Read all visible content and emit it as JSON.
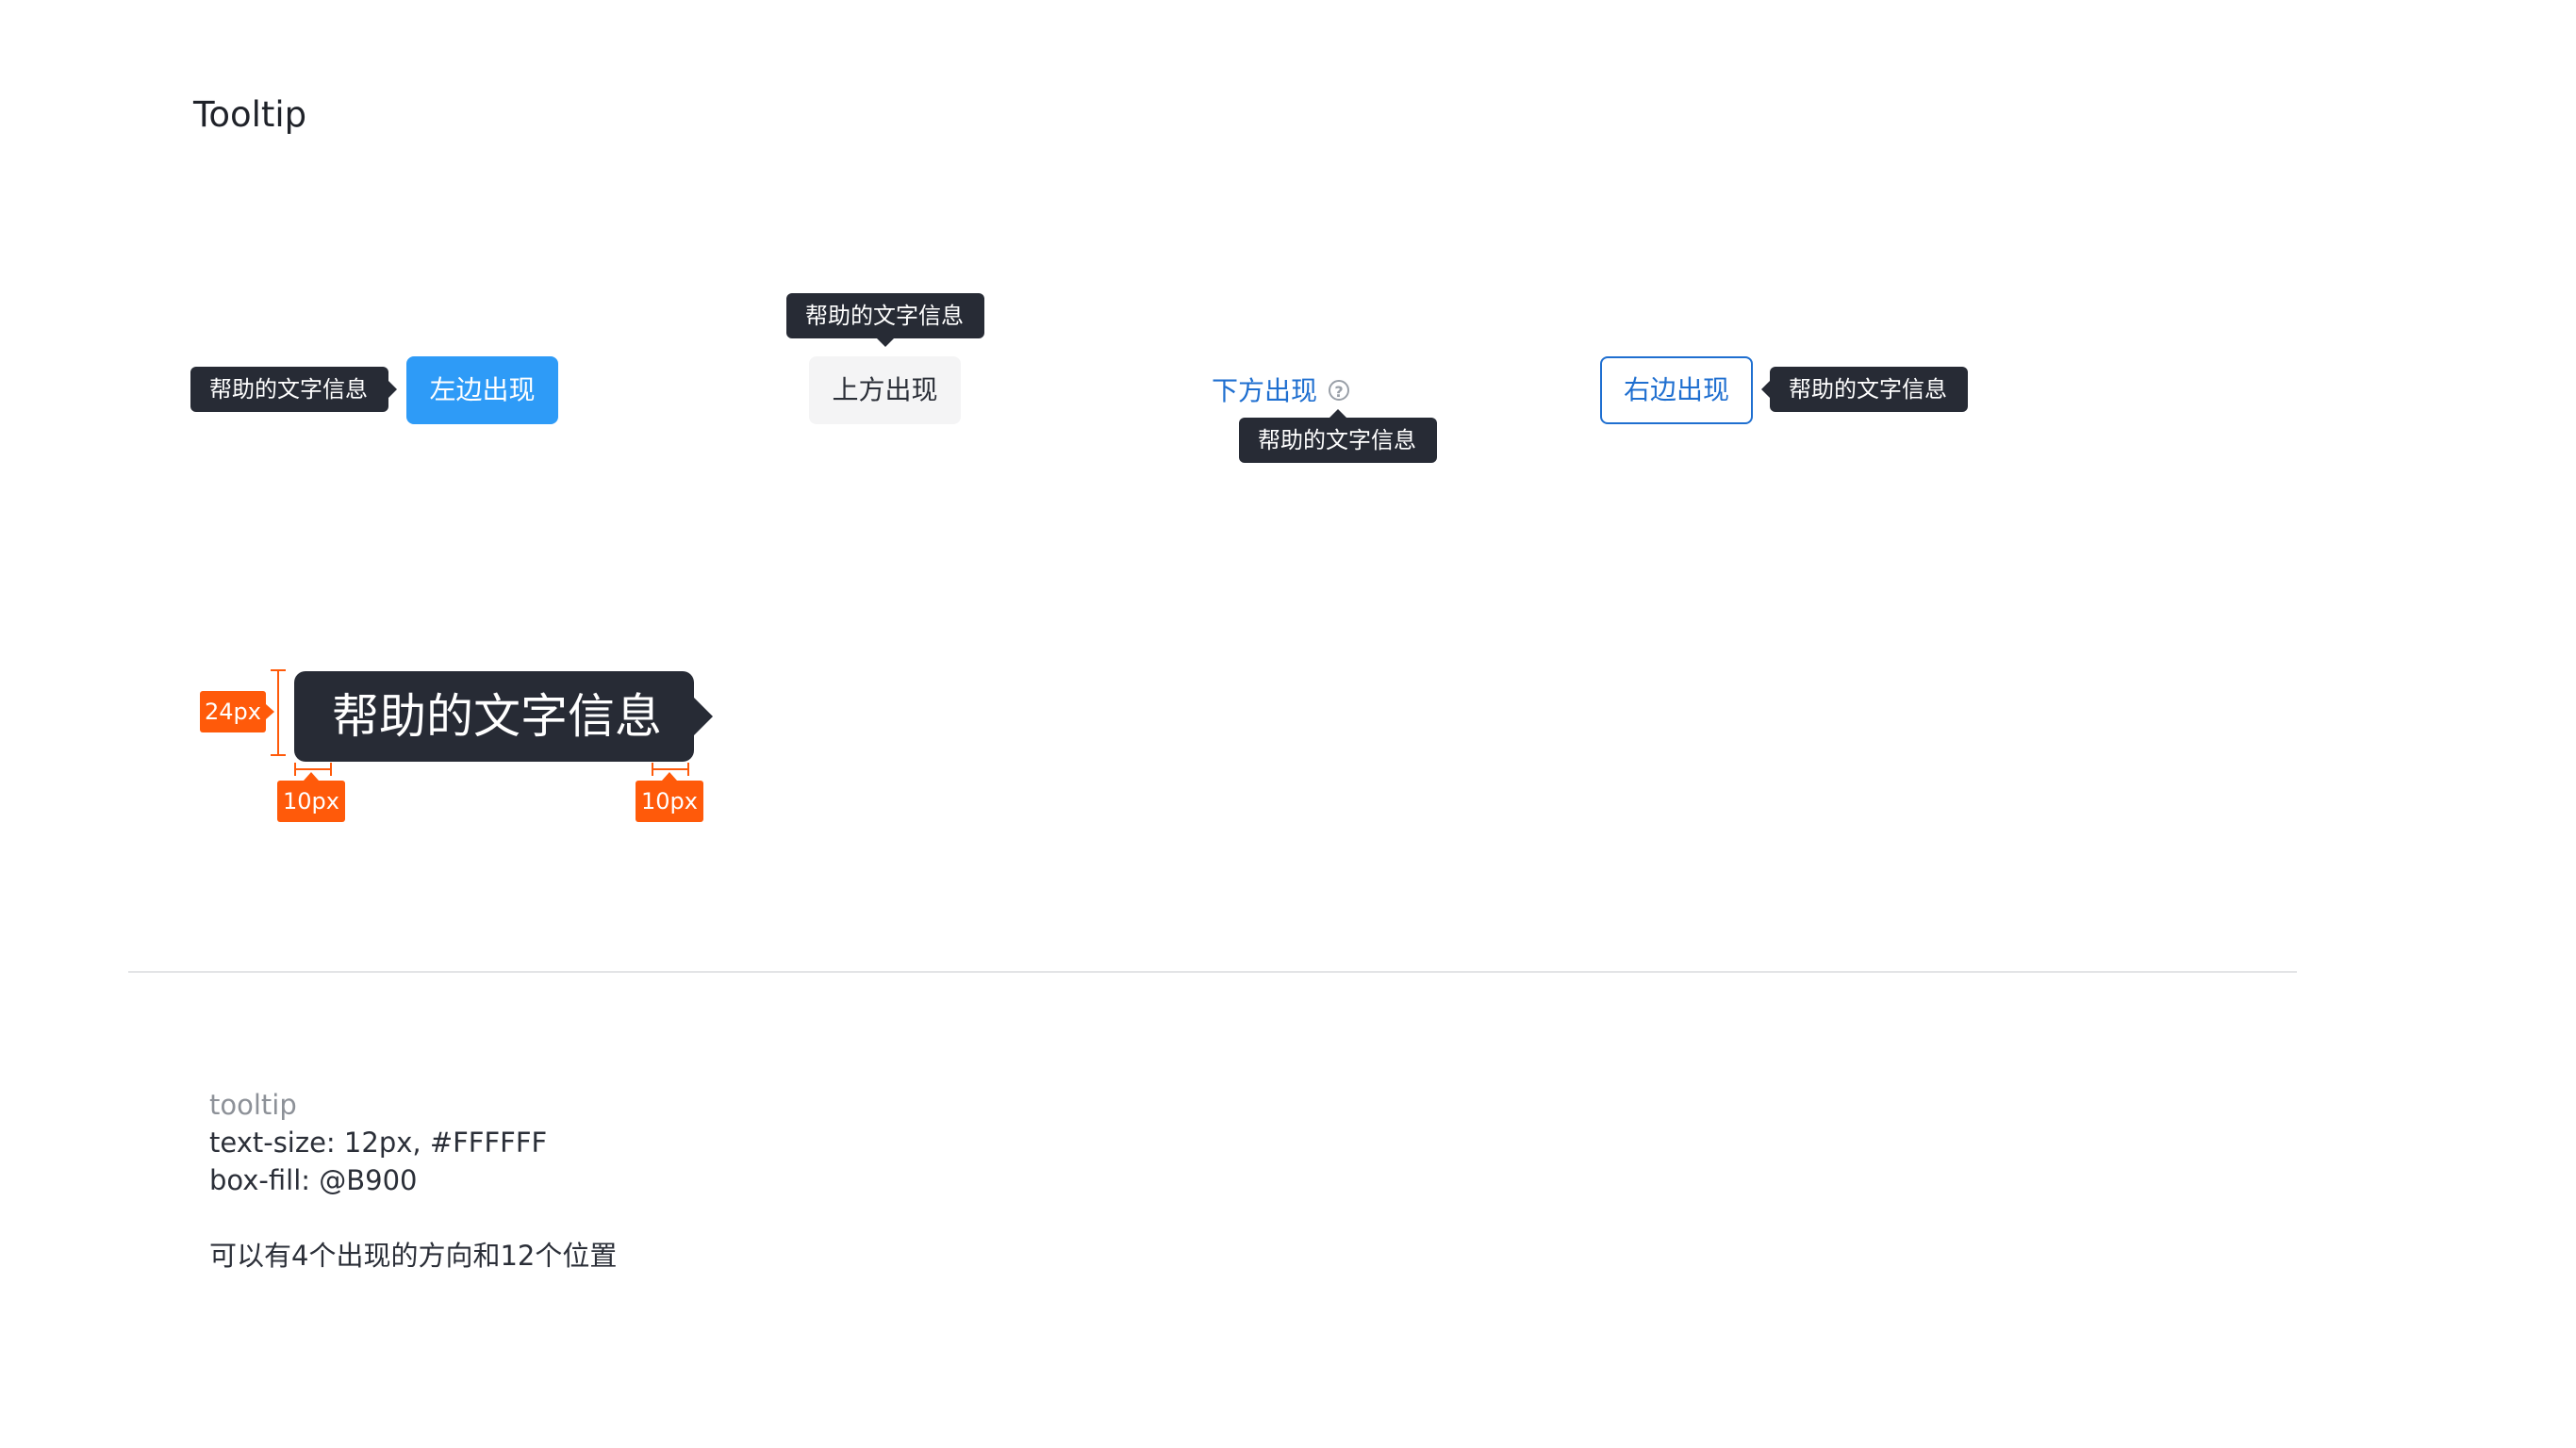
{
  "page": {
    "title": "Tooltip"
  },
  "tooltip_text": "帮助的文字信息",
  "examples": {
    "left": {
      "button_label": "左边出现"
    },
    "top": {
      "button_label": "上方出现"
    },
    "bottom": {
      "link_label": "下方出现",
      "icon": "question-circle-icon"
    },
    "right": {
      "button_label": "右边出现"
    }
  },
  "spec_diagram": {
    "tooltip_text": "帮助的文字信息",
    "height_label": "24px",
    "padding_left_label": "10px",
    "padding_right_label": "10px"
  },
  "colors": {
    "tooltip_fill": "#272b35",
    "primary": "#2e9bf7",
    "link": "#1f6fd0",
    "measure": "#ff5a0a"
  },
  "spec": {
    "caption": "tooltip",
    "text_size": "text-size: 12px, #FFFFFF",
    "box_fill": "box-fill: @B900",
    "note": "可以有4个出现的方向和12个位置"
  }
}
